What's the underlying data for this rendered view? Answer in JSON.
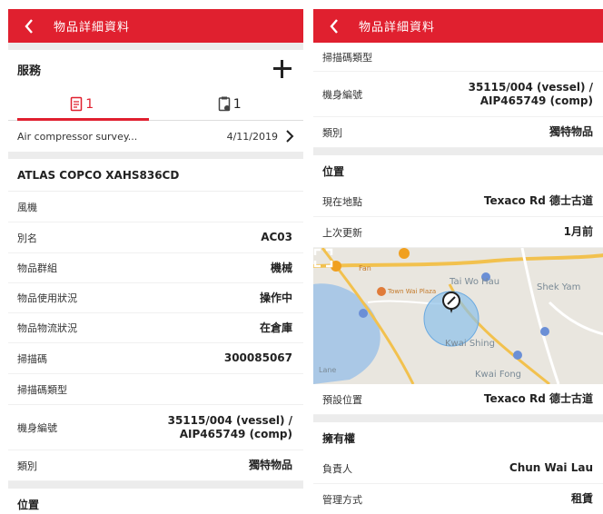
{
  "left": {
    "appbar_title": "物品詳細資料",
    "service": {
      "title": "服務",
      "tab_docs_count": "1",
      "tab_tasks_count": "1"
    },
    "survey": {
      "name": "Air compressor survey...",
      "date": "4/11/2019"
    },
    "asset": {
      "name": "ATLAS COPCO XAHS836CD",
      "category": "風機",
      "rows": [
        {
          "label": "別名",
          "value": "AC03"
        },
        {
          "label": "物品群組",
          "value": "機械"
        },
        {
          "label": "物品使用狀況",
          "value": "操作中"
        },
        {
          "label": "物品物流狀況",
          "value": "在倉庫"
        },
        {
          "label": "掃描碼",
          "value": "300085067"
        },
        {
          "label": "掃描碼類型",
          "value": ""
        },
        {
          "label": "機身編號",
          "value_line1": "35115/004 (vessel) /",
          "value_line2": "AIP465749 (comp)"
        },
        {
          "label": "類別",
          "value": "獨特物品"
        }
      ]
    },
    "location_title": "位置"
  },
  "right": {
    "appbar_title": "物品詳細資料",
    "rows": [
      {
        "label": "掃描碼類型",
        "value": ""
      },
      {
        "label": "機身編號",
        "value_line1": "35115/004 (vessel) /",
        "value_line2": "AIP465749 (comp)"
      },
      {
        "label": "類別",
        "value": "獨特物品"
      }
    ],
    "location": {
      "title": "位置",
      "current_label": "現在地點",
      "current_value": "Texaco Rd 德士古道",
      "updated_label": "上次更新",
      "updated_value": "1月前",
      "map_labels": {
        "tai_wo_hau": "Tai Wo Hau",
        "shek_yam": "Shek Yam",
        "kwai_shing": "Kwai Shing",
        "kwai_fong": "Kwai Fong",
        "town_mall": "Town Wai Plaza",
        "fan": "Fan",
        "lane": "Lane"
      },
      "default_label": "預設位置",
      "default_value": "Texaco Rd 德士古道"
    },
    "ownership": {
      "title": "擁有權",
      "owner_label": "負責人",
      "owner_value": "Chun Wai Lau",
      "method_label": "管理方式",
      "method_value": "租賃"
    }
  },
  "colors": {
    "brand_red": "#e0202f",
    "map_water": "#aac8e6",
    "map_accuracy": "#8cc0ea"
  }
}
